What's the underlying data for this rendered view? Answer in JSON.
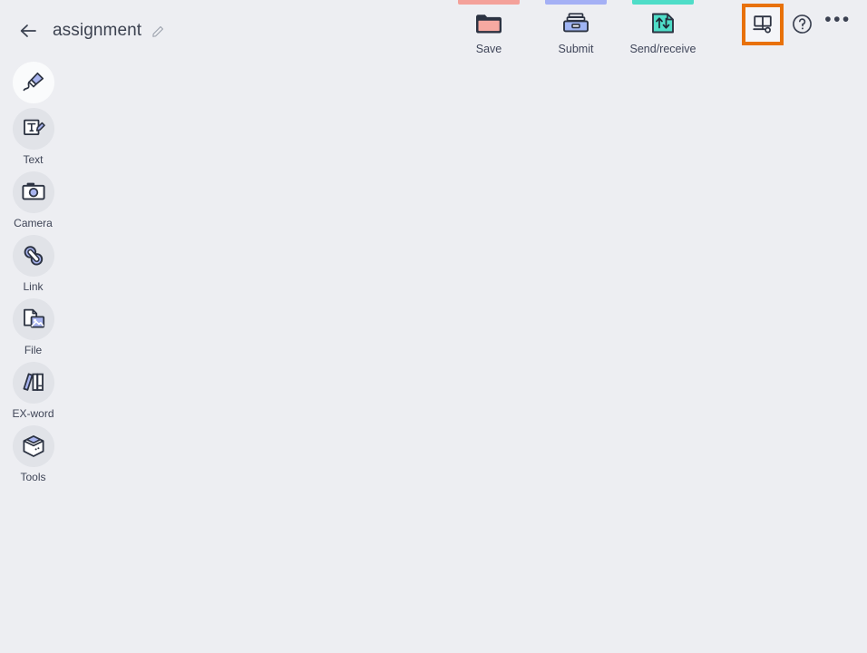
{
  "app": {
    "background_color": "#edeef2",
    "title": "assignment"
  },
  "header": {
    "back_label": "back-arrow",
    "document_title": "assignment",
    "edit_title_label": "edit-pencil"
  },
  "toolbar": {
    "items": [
      {
        "label": "Save",
        "icon": "folder-icon",
        "accent": "#f4a19a"
      },
      {
        "label": "Submit",
        "icon": "inbox-tray-icon",
        "accent": "#a4b0f5"
      },
      {
        "label": "Send/receive",
        "icon": "send-receive-icon",
        "accent": "#4fddc8"
      }
    ]
  },
  "right_actions": {
    "items": [
      {
        "name": "presentation-board-icon",
        "highlighted": true,
        "highlight_color": "#e8710a"
      },
      {
        "name": "help-icon",
        "highlighted": false,
        "highlight_color": ""
      },
      {
        "name": "more-options-icon",
        "highlighted": false,
        "highlight_color": "",
        "glyph": "•••"
      }
    ]
  },
  "sidebar": {
    "items": [
      {
        "label": "",
        "icon": "pen-marker-icon",
        "selected": true
      },
      {
        "label": "Text",
        "icon": "text-icon",
        "selected": false
      },
      {
        "label": "Camera",
        "icon": "camera-icon",
        "selected": false
      },
      {
        "label": "Link",
        "icon": "link-icon",
        "selected": false
      },
      {
        "label": "File",
        "icon": "file-image-icon",
        "selected": false
      },
      {
        "label": "EX-word",
        "icon": "books-icon",
        "selected": false
      },
      {
        "label": "Tools",
        "icon": "toolbox-icon",
        "selected": false
      }
    ]
  },
  "canvas": {
    "content": ""
  }
}
